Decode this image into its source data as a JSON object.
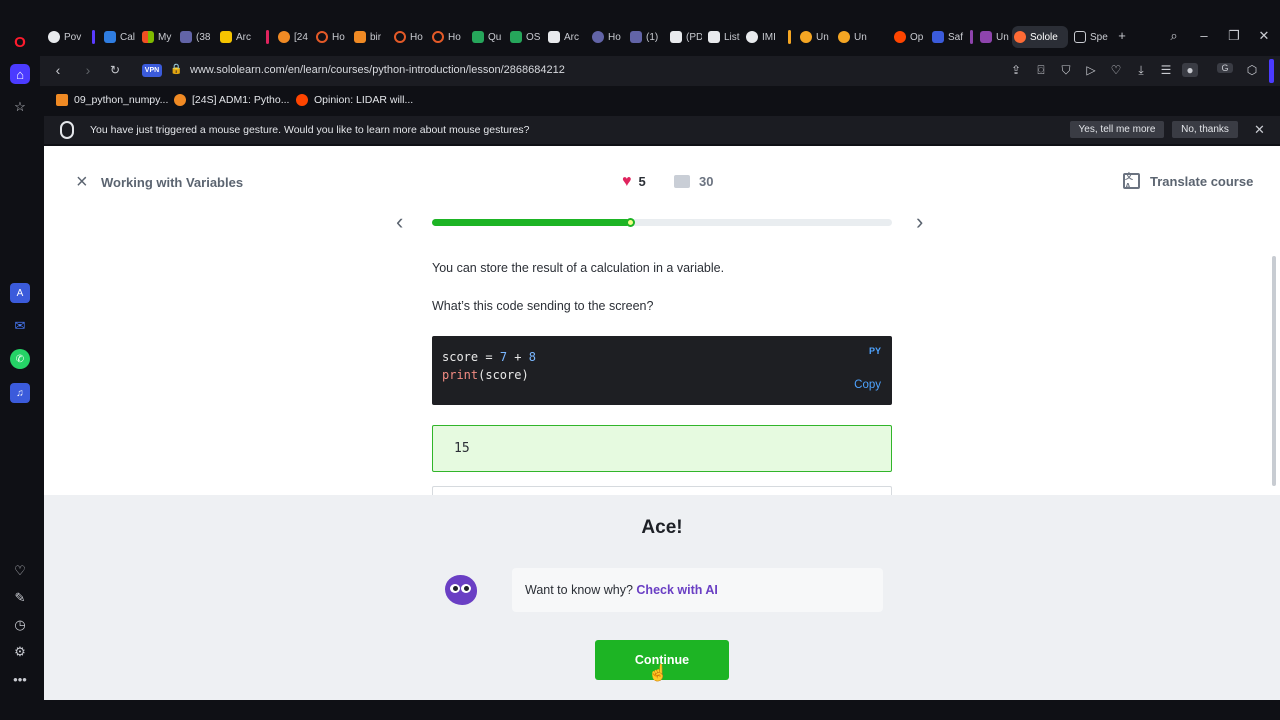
{
  "browser": {
    "tabs": [
      {
        "label": "Pov",
        "color": "#e8eaed"
      },
      {
        "label": "Cal",
        "color": "#2f7de1"
      },
      {
        "label": "My",
        "color": "#f25022"
      },
      {
        "label": "(38",
        "color": "#6264a7"
      },
      {
        "label": "Arc",
        "color": "#f5c400"
      },
      {
        "label": "[24",
        "color": "#f08a24"
      },
      {
        "label": "Ho",
        "color": "#e45a28"
      },
      {
        "label": "bir",
        "color": "#f08a24"
      },
      {
        "label": "Ho",
        "color": "#e45a28"
      },
      {
        "label": "Ho",
        "color": "#e45a28"
      },
      {
        "label": "Qu",
        "color": "#26a65b"
      },
      {
        "label": "OS",
        "color": "#26a65b"
      },
      {
        "label": "Arc",
        "color": "#e8eaed"
      },
      {
        "label": "Ho",
        "color": "#6264a7"
      },
      {
        "label": "(1)",
        "color": "#6264a7"
      },
      {
        "label": "(PD",
        "color": "#e8eaed"
      },
      {
        "label": "List",
        "color": "#e8eaed"
      },
      {
        "label": "IMI",
        "color": "#e8eaed"
      },
      {
        "label": "Un",
        "color": "#f5a623"
      },
      {
        "label": "Un",
        "color": "#f5a623"
      },
      {
        "label": "Op",
        "color": "#ff4500"
      },
      {
        "label": "Saf",
        "color": "#3b5bdb"
      },
      {
        "label": "Un",
        "color": "#8e44ad"
      },
      {
        "label": "Solole",
        "color": "#ff6b35"
      },
      {
        "label": "Spe",
        "color": "#c9cbd1"
      }
    ],
    "url": "www.sololearn.com/en/learn/courses/python-introduction/lesson/2868684212",
    "vpn_label": "VPN",
    "bookmarks": [
      {
        "label": "09_python_numpy...",
        "color": "#f08a24"
      },
      {
        "label": "[24S] ADM1: Pytho...",
        "color": "#f08a24"
      },
      {
        "label": "Opinion: LIDAR will...",
        "color": "#ff4500"
      }
    ],
    "gesture_notice": {
      "text": "You have just triggered a mouse gesture. Would you like to learn more about mouse gestures?",
      "yes_label": "Yes, tell me more",
      "no_label": "No, thanks"
    }
  },
  "lesson": {
    "title": "Working with Variables",
    "likes": "5",
    "comments": "30",
    "translate_label": "Translate course",
    "progress_fraction": 0.43,
    "paragraph1": "You can store the result of a calculation in a variable.",
    "question": "What’s this code sending to the screen?",
    "code_lang": "PY",
    "copy_label": "Copy",
    "code_line1_var": "score",
    "code_line1_op": " = ",
    "code_line1_a": "7",
    "code_line1_plus": " + ",
    "code_line1_b": "8",
    "code_line2_fn": "print",
    "code_line2_rest": "(score)",
    "answer": "15"
  },
  "result": {
    "headline": "Ace!",
    "why_prompt": "Want to know why?",
    "why_link": "Check with AI",
    "continue_label": "Continue"
  },
  "icons": {
    "close": "×",
    "heart": "♥",
    "prev": "‹",
    "next": "›"
  }
}
